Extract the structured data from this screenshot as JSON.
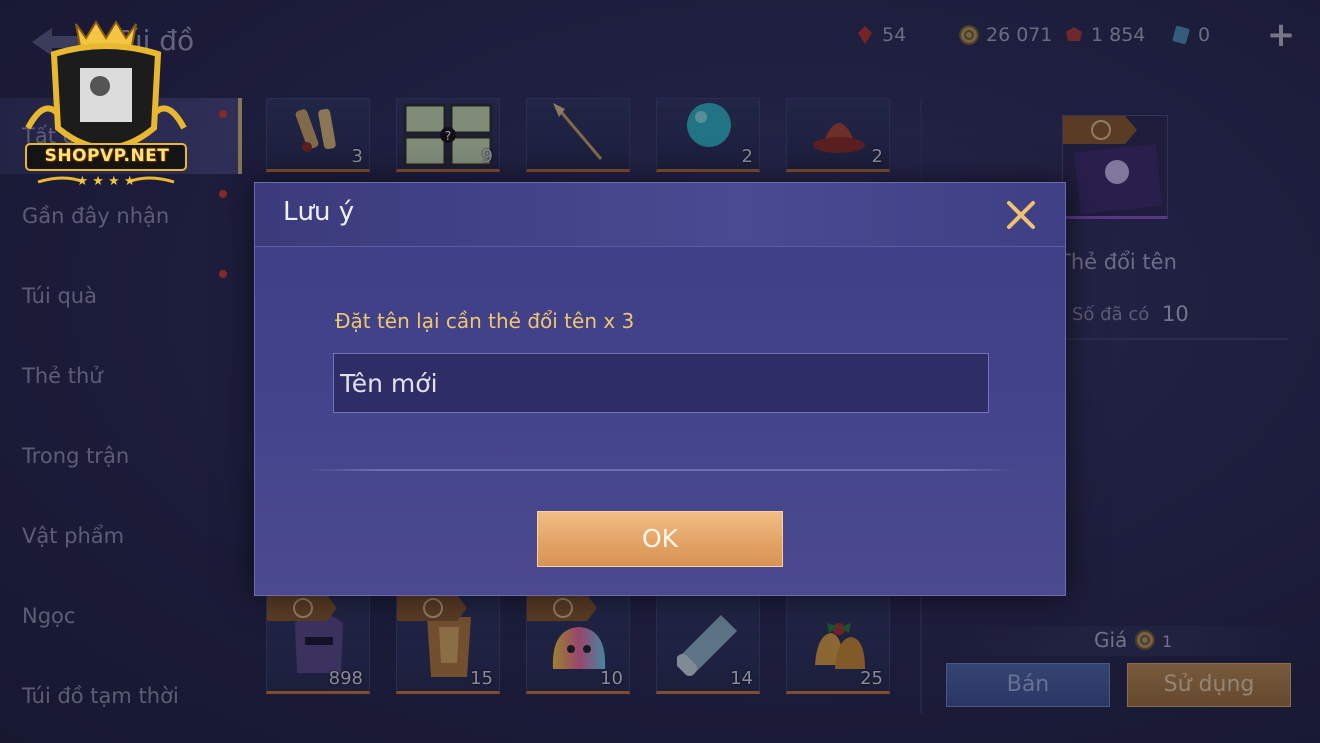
{
  "header": {
    "title": "Túi đồ",
    "currencies": [
      {
        "icon": "red-crystal-icon",
        "value": "54"
      },
      {
        "icon": "gold-coin-icon",
        "value": "26 071"
      },
      {
        "icon": "red-gem-icon",
        "value": "1 854"
      },
      {
        "icon": "blue-ticket-icon",
        "value": "0"
      }
    ],
    "plus_label": "+"
  },
  "sidebar": {
    "items": [
      {
        "label": "Tất cả",
        "active": true,
        "dot": true
      },
      {
        "label": "Gần đây nhận",
        "dot": true
      },
      {
        "label": "Túi quà",
        "dot": true
      },
      {
        "label": "Thẻ thử"
      },
      {
        "label": "Trong trận"
      },
      {
        "label": "Vật phẩm"
      },
      {
        "label": "Ngọc"
      },
      {
        "label": "Túi đồ tạm thời"
      }
    ]
  },
  "grid": {
    "top_row": [
      {
        "icon": "scroll-bundle-icon",
        "count": "3"
      },
      {
        "icon": "mystery-cards-icon",
        "count": "9"
      },
      {
        "icon": "spear-icon",
        "count": ""
      },
      {
        "icon": "cyan-orb-icon",
        "count": "2"
      },
      {
        "icon": "red-hat-icon",
        "count": "2"
      }
    ],
    "bottom_row": [
      {
        "icon": "purple-helmet-icon",
        "count": "898",
        "badge": true
      },
      {
        "icon": "golden-armor-icon",
        "count": "15",
        "badge": true
      },
      {
        "icon": "rainbow-slime-icon",
        "count": "10",
        "badge": true
      },
      {
        "icon": "map-scroll-icon",
        "count": "14"
      },
      {
        "icon": "christmas-bells-icon",
        "count": "25"
      }
    ]
  },
  "detail": {
    "name": "Thẻ đổi tên",
    "have_label": "Số đã có",
    "have_value": "10",
    "price_label": "Giá",
    "price_value": "1",
    "sell_label": "Bán",
    "use_label": "Sử dụng"
  },
  "dialog": {
    "title": "Lưu ý",
    "message": "Đặt tên lại cần thẻ đổi tên x 3",
    "input_placeholder": "Tên mới",
    "ok_label": "OK"
  },
  "watermark": {
    "text": "SHOPVP.NET",
    "stars": "★ ★ ★ ★"
  },
  "colors": {
    "accent_gold": "#f0c76b",
    "ok_button": "#e4a367",
    "dialog_bg": "#43438c"
  }
}
